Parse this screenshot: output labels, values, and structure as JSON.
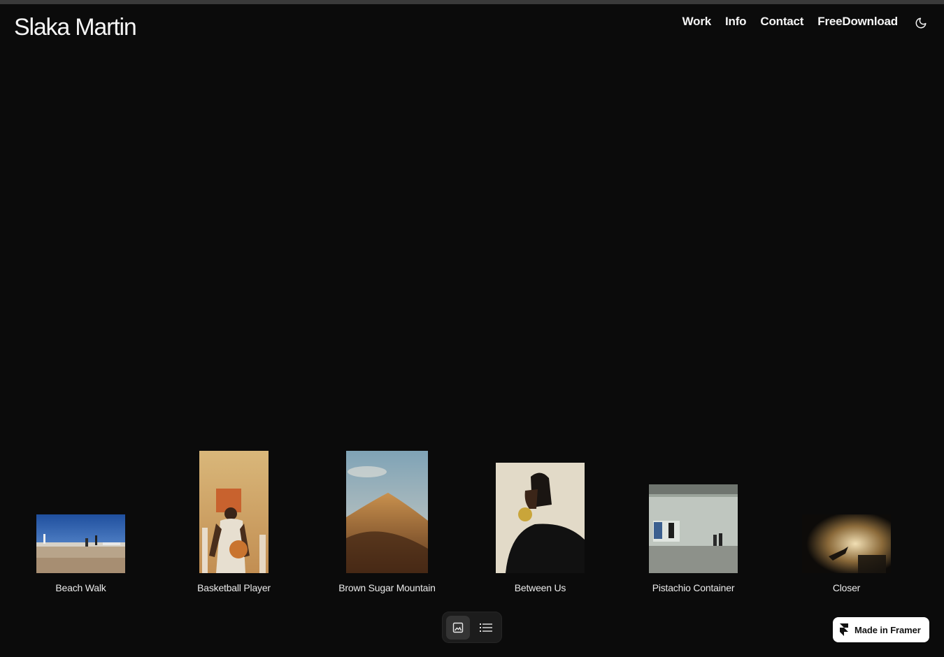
{
  "brand": {
    "name": "Slaka Martin"
  },
  "nav": {
    "items": [
      {
        "label": "Work"
      },
      {
        "label": "Info"
      },
      {
        "label": "Contact"
      },
      {
        "label": "FreeDownload"
      }
    ],
    "theme_toggle_icon": "moon-icon"
  },
  "gallery": {
    "items": [
      {
        "title": "Beach Walk"
      },
      {
        "title": "Basketball Player"
      },
      {
        "title": "Brown Sugar Mountain"
      },
      {
        "title": "Between Us"
      },
      {
        "title": "Pistachio Container"
      },
      {
        "title": "Closer"
      }
    ]
  },
  "view_switch": {
    "options": [
      {
        "icon": "image-grid-icon",
        "active": true
      },
      {
        "icon": "list-icon",
        "active": false
      }
    ]
  },
  "badge": {
    "label": "Made in Framer",
    "icon": "framer-logo-icon"
  }
}
